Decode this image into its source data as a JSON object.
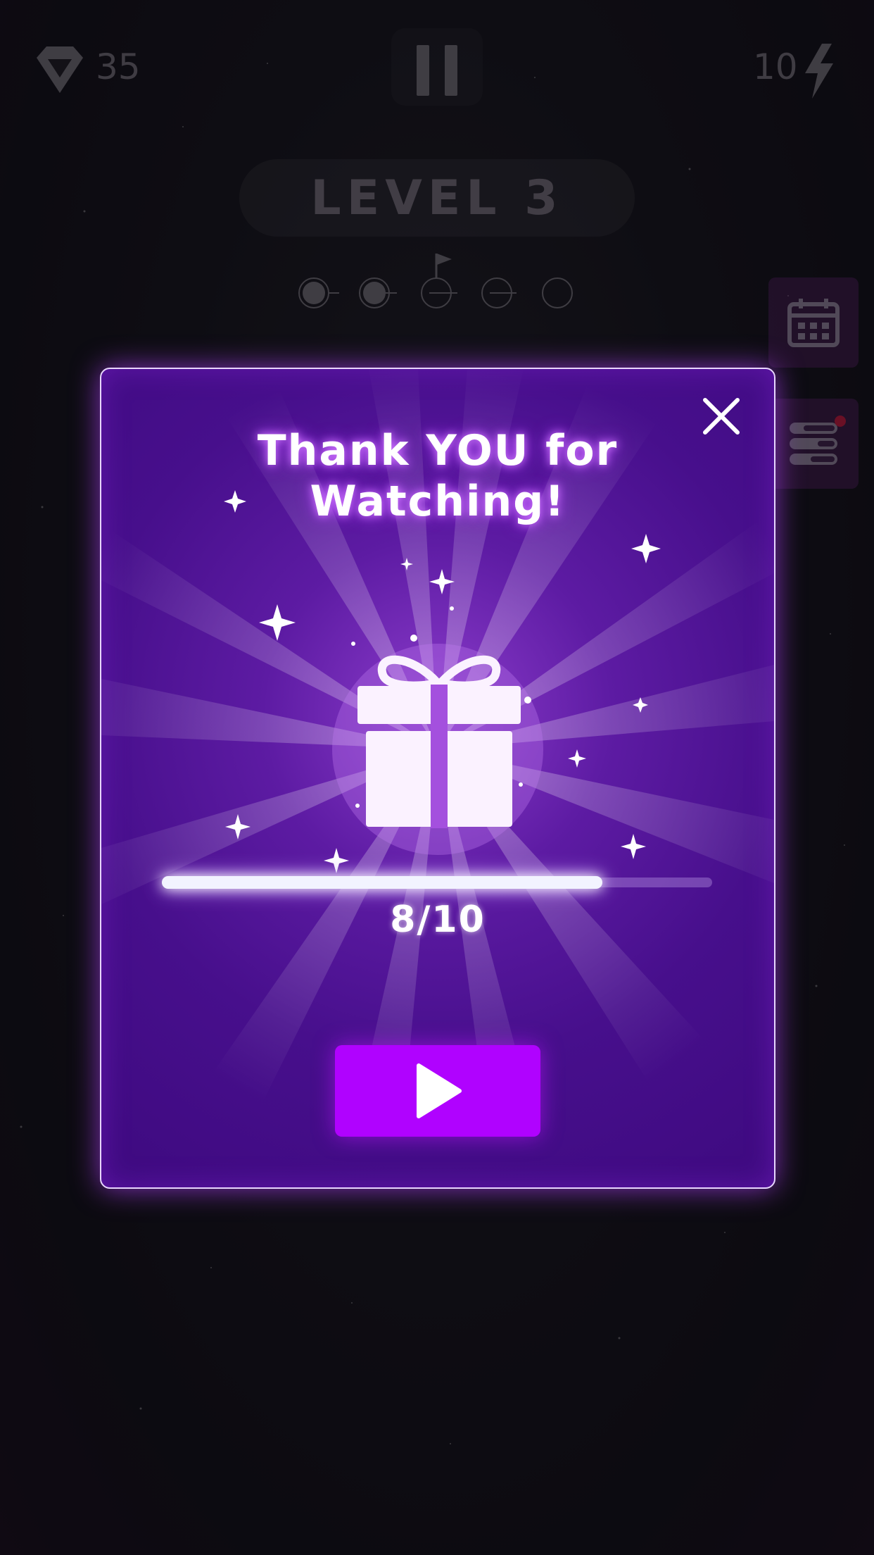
{
  "hud": {
    "gems_count": "35",
    "gem_icon": "diamond-icon",
    "pause_icon": "pause-icon",
    "energy_count": "10",
    "energy_icon": "lightning-bolt-icon"
  },
  "level": {
    "label": "LEVEL 3",
    "stages_total": 5,
    "stages_completed": 2,
    "flag_stage": 3
  },
  "side_buttons": {
    "calendar_icon": "calendar-icon",
    "menu_icon": "menu-list-icon",
    "has_notification": true
  },
  "modal": {
    "title_line1": "Thank YOU for",
    "title_line2": "Watching!",
    "close_icon": "close-icon",
    "gift_icon": "gift-icon",
    "progress_current": 8,
    "progress_total": 10,
    "progress_text": "8/10",
    "play_icon": "play-icon"
  },
  "colors": {
    "modal_bg": "#4a1090",
    "modal_border": "#e8d6ff",
    "play_button": "#b002ff",
    "title_glow": "#d27aff",
    "hud_text": "#6a6670",
    "notification": "#b6163a"
  }
}
